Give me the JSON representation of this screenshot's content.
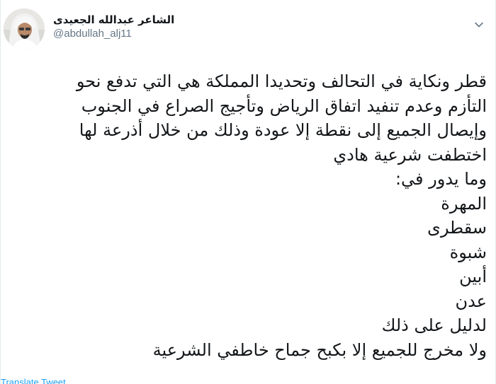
{
  "header": {
    "display_name": "الشاعر عبدالله الجعيدى",
    "handle": "@abdullah_alj11",
    "menu_icon": "chevron-down-icon",
    "avatar_icon": "avatar"
  },
  "tweet": {
    "lines": [
      "قطر ونكاية في التحالف وتحديدا المملكة هي التي تدفع نحو",
      "التأزم وعدم تنفيد اتفاق الرياض وتأجيج الصراع في الجنوب",
      "وإيصال الجميع إلى نقطة إلا عودة وذلك من خلال أذرعة لها",
      "اختطفت شرعية هادي",
      "وما يدور في:",
      "المهرة",
      "سقطرى",
      "شبوة",
      "أبين",
      "عدن",
      "لدليل على ذلك",
      "ولا مخرج للجميع إلا بكبح جماح خاطفي الشرعية"
    ]
  },
  "footer": {
    "translate_label": "Translate Tweet"
  },
  "colors": {
    "text": "#14171a",
    "muted": "#657786",
    "link": "#1da1f2"
  }
}
